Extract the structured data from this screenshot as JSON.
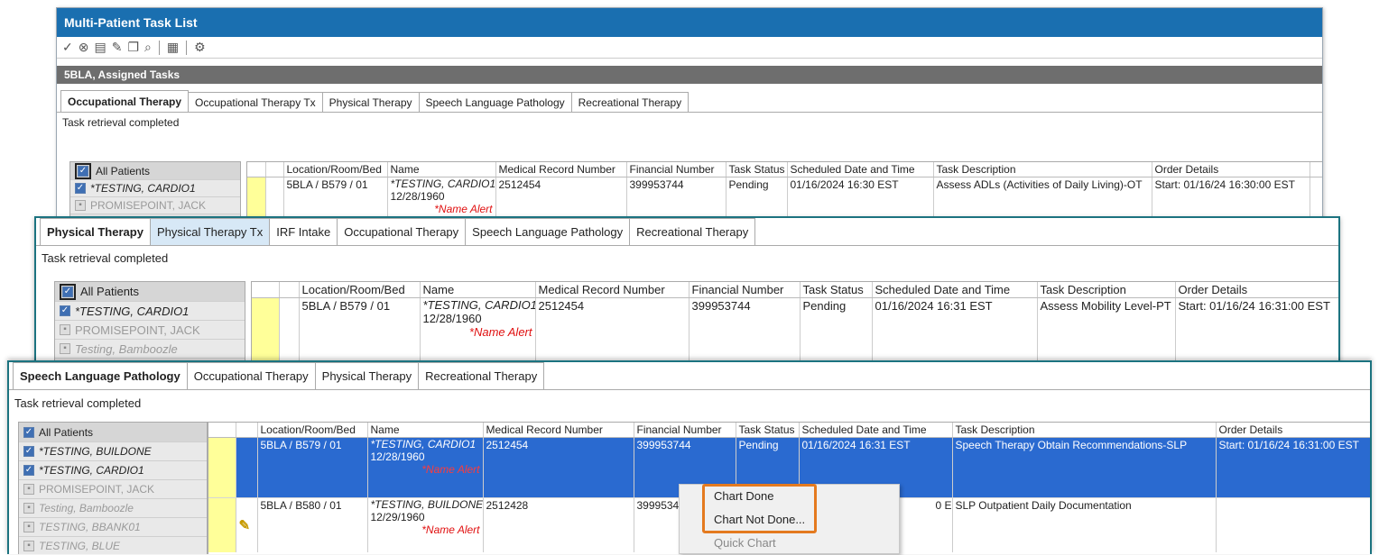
{
  "window": {
    "title": "Multi-Patient Task List"
  },
  "toolbar": {
    "icons": [
      "check-icon",
      "cancel-icon",
      "doc-icon",
      "doc-edit-icon",
      "doc-multi-icon",
      "doc-search-icon",
      "print-icon",
      "settings-icon"
    ]
  },
  "section": {
    "title": "5BLA, Assigned Tasks"
  },
  "panel1": {
    "tabs": [
      "Occupational Therapy",
      "Occupational Therapy Tx",
      "Physical Therapy",
      "Speech Language Pathology",
      "Recreational Therapy"
    ],
    "status": "Task retrieval completed",
    "patients": [
      "All Patients",
      "*TESTING, CARDIO1",
      "PROMISEPOINT, JACK"
    ],
    "columns": [
      "Location/Room/Bed",
      "Name",
      "Medical Record Number",
      "Financial Number",
      "Task Status",
      "Scheduled Date and Time",
      "Task Description",
      "Order Details"
    ],
    "row": {
      "location": "5BLA / B579 / 01",
      "name": "*TESTING, CARDIO1",
      "dob": "12/28/1960",
      "alert": "*Name Alert",
      "mrn": "2512454",
      "fin": "399953744",
      "status": "Pending",
      "sched": "01/16/2024  16:30 EST",
      "desc": "Assess ADLs (Activities of Daily Living)-OT",
      "order": "Start: 01/16/24 16:30:00 EST"
    }
  },
  "panel2": {
    "tabs": [
      "Physical Therapy",
      "Physical Therapy Tx",
      "IRF Intake",
      "Occupational Therapy",
      "Speech Language Pathology",
      "Recreational Therapy"
    ],
    "status": "Task retrieval completed",
    "patients": [
      "All Patients",
      "*TESTING, CARDIO1",
      "PROMISEPOINT, JACK",
      "Testing, Bamboozle"
    ],
    "columns": [
      "Location/Room/Bed",
      "Name",
      "Medical Record Number",
      "Financial Number",
      "Task Status",
      "Scheduled Date and Time",
      "Task Description",
      "Order Details"
    ],
    "row": {
      "location": "5BLA / B579 / 01",
      "name": "*TESTING, CARDIO1",
      "dob": "12/28/1960",
      "alert": "*Name Alert",
      "mrn": "2512454",
      "fin": "399953744",
      "status": "Pending",
      "sched": "01/16/2024   16:31 EST",
      "desc": "Assess Mobility Level-PT",
      "order": "Start: 01/16/24 16:31:00 EST"
    }
  },
  "panel3": {
    "tabs": [
      "Speech Language Pathology",
      "Occupational Therapy",
      "Physical Therapy",
      "Recreational Therapy"
    ],
    "status": "Task retrieval completed",
    "patients": [
      "All Patients",
      "*TESTING, BUILDONE",
      "*TESTING, CARDIO1",
      "PROMISEPOINT, JACK",
      "Testing, Bamboozle",
      "TESTING, BBANK01",
      "TESTING, BLUE"
    ],
    "columns": [
      "Location/Room/Bed",
      "Name",
      "Medical Record Number",
      "Financial Number",
      "Task Status",
      "Scheduled Date and Time",
      "Task Description",
      "Order Details"
    ],
    "rows": [
      {
        "location": "5BLA / B579 / 01",
        "name": "*TESTING, CARDIO1",
        "dob": "12/28/1960",
        "alert": "*Name Alert",
        "mrn": "2512454",
        "fin": "399953744",
        "status": "Pending",
        "sched": "01/16/2024   16:31 EST",
        "desc": "Speech Therapy Obtain Recommendations-SLP",
        "order": "Start: 01/16/24 16:31:00 EST"
      },
      {
        "location": "5BLA / B580 / 01",
        "name": "*TESTING, BUILDONE",
        "dob": "12/29/1960",
        "alert": "*Name Alert",
        "mrn": "2512428",
        "fin": "3999534",
        "status": "",
        "sched": "0 EST",
        "desc": "SLP Outpatient Daily Documentation",
        "order": ""
      }
    ]
  },
  "context_menu": {
    "items": [
      "Chart Done",
      "Chart Not Done...",
      "Quick Chart"
    ]
  },
  "colors": {
    "title_bar": "#1a6fb0",
    "selected_row": "#2a6ad0",
    "highlight_box": "#e47a1f",
    "name_alert": "#e01010",
    "order_column": "#ffff99"
  }
}
